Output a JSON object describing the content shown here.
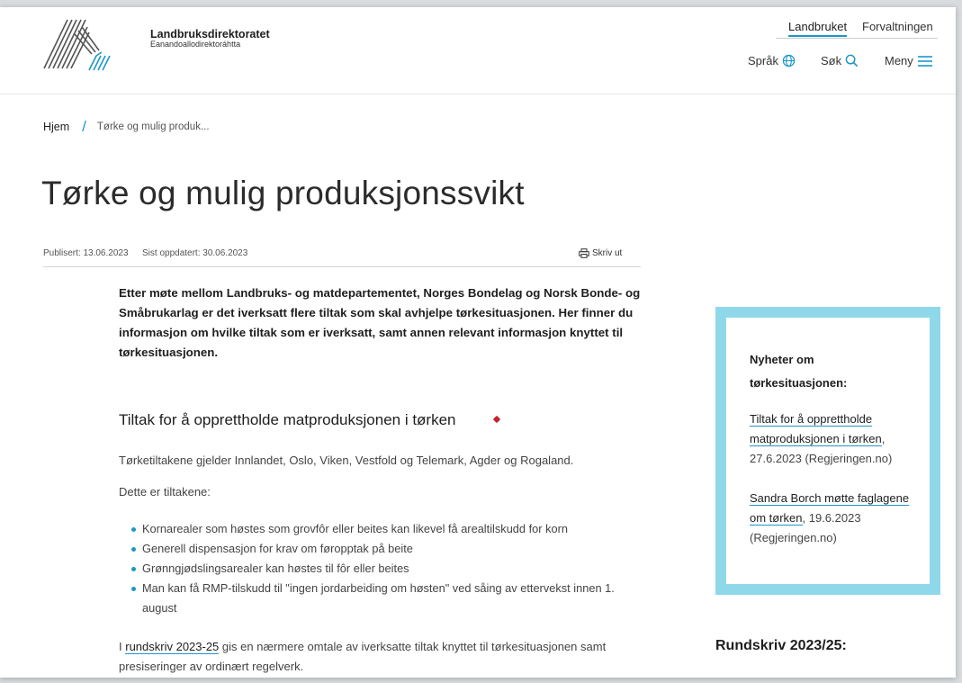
{
  "header": {
    "org_name": "Landbruksdirektoratet",
    "org_subname": "Eanandoallodirektoráhtta",
    "tabs": [
      {
        "label": "Landbruket",
        "active": true
      },
      {
        "label": "Forvaltningen",
        "active": false
      }
    ],
    "utilities": {
      "language": {
        "label": "Språk",
        "icon": "globe-icon"
      },
      "search": {
        "label": "Søk",
        "icon": "search-icon"
      },
      "menu": {
        "label": "Meny",
        "icon": "hamburger-icon"
      }
    }
  },
  "breadcrumb": {
    "home": "Hjem",
    "separator": "/",
    "current": "Tørke og mulig produk..."
  },
  "article": {
    "title": "Tørke og mulig produksjonssvikt",
    "published": "Publisert: 13.06.2023",
    "updated": "Sist oppdatert: 30.06.2023",
    "print_label": "Skriv ut",
    "lead": "Etter møte mellom Landbruks- og matdepartementet, Norges Bondelag og Norsk Bonde- og Småbrukarlag er det iverksatt flere tiltak som skal avhjelpe tørkesituasjonen. Her finner du informasjon om hvilke tiltak som er iverksatt, samt annen relevant informasjon knyttet til tørkesituasjonen.",
    "section_heading": "Tiltak for å opprettholde matproduksjonen i tørken",
    "para1": "Tørketiltakene gjelder Innlandet, Oslo, Viken, Vestfold og Telemark, Agder og Rogaland.",
    "para2": "Dette er tiltakene:",
    "bullets": [
      "Kornarealer som høstes som grovfôr eller beites kan likevel få arealtilskudd for korn",
      "Generell dispensasjon for krav om føropptak på beite",
      "Grønngjødslingsarealer kan høstes til fôr eller beites",
      "Man kan få RMP-tilskudd til \"ingen jordarbeiding om høsten\" ved såing av ettervekst innen 1. august"
    ],
    "para3_prefix": "I ",
    "para3_link": "rundskriv 2023-25",
    "para3_suffix": " gis en nærmere omtale av iverksatte tiltak knyttet til tørkesituasjonen samt presiseringer av ordinært regelverk."
  },
  "sidebar": {
    "news_title": "Nyheter om tørkesituasjonen:",
    "news": [
      {
        "link": "Tiltak for å opprettholde matproduksjonen i tørken",
        "suffix": ", 27.6.2023 (Regjeringen.no)"
      },
      {
        "link": "Sandra Borch møtte faglagene om tørken",
        "suffix": ", 19.6.2023 (Regjeringen.no)"
      }
    ],
    "rundskriv_heading": "Rundskriv 2023/25:"
  },
  "colors": {
    "accent": "#1d97c6",
    "box_border": "#8fd8ea",
    "text": "#1e1e1e"
  }
}
